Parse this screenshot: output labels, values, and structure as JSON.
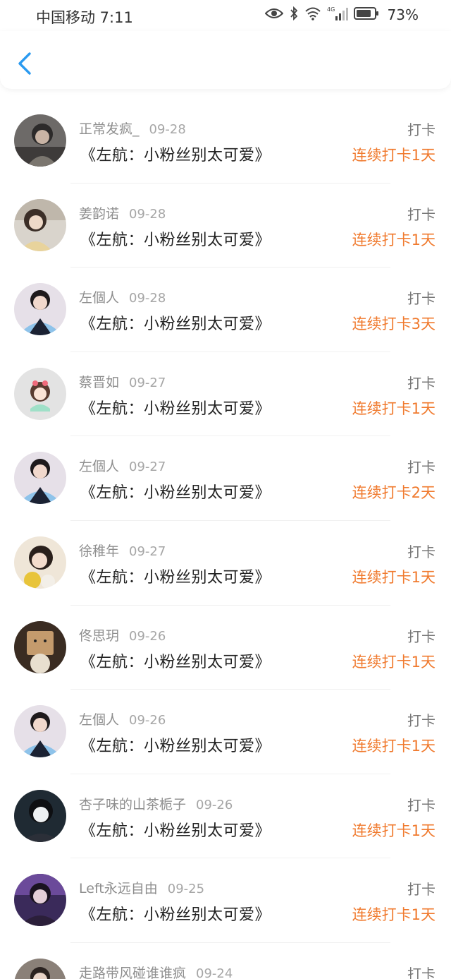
{
  "status_bar": {
    "carrier_time": "中国移动 7:11",
    "network": "4G",
    "battery": "73%"
  },
  "nav": {
    "back_icon": "chevron-left-icon",
    "accent": "#2a9af0"
  },
  "colors": {
    "streak": "#f07a2e",
    "meta": "#8e8e8e"
  },
  "entries": [
    {
      "user": "正常发疯_",
      "date": "09-28",
      "book": "《左航：小粉丝别太可爱》",
      "type": "打卡",
      "streak": "连续打卡1天"
    },
    {
      "user": "姜韵诺",
      "date": "09-28",
      "book": "《左航：小粉丝别太可爱》",
      "type": "打卡",
      "streak": "连续打卡1天"
    },
    {
      "user": "左個人",
      "date": "09-28",
      "book": "《左航：小粉丝别太可爱》",
      "type": "打卡",
      "streak": "连续打卡3天"
    },
    {
      "user": "蔡晋如",
      "date": "09-27",
      "book": "《左航：小粉丝别太可爱》",
      "type": "打卡",
      "streak": "连续打卡1天"
    },
    {
      "user": "左個人",
      "date": "09-27",
      "book": "《左航：小粉丝别太可爱》",
      "type": "打卡",
      "streak": "连续打卡2天"
    },
    {
      "user": "徐稚年",
      "date": "09-27",
      "book": "《左航：小粉丝别太可爱》",
      "type": "打卡",
      "streak": "连续打卡1天"
    },
    {
      "user": "佟思玥",
      "date": "09-26",
      "book": "《左航：小粉丝别太可爱》",
      "type": "打卡",
      "streak": "连续打卡1天"
    },
    {
      "user": "左個人",
      "date": "09-26",
      "book": "《左航：小粉丝别太可爱》",
      "type": "打卡",
      "streak": "连续打卡1天"
    },
    {
      "user": "杏子味的山茶栀子",
      "date": "09-26",
      "book": "《左航：小粉丝别太可爱》",
      "type": "打卡",
      "streak": "连续打卡1天"
    },
    {
      "user": "Left永远自由",
      "date": "09-25",
      "book": "《左航：小粉丝别太可爱》",
      "type": "打卡",
      "streak": "连续打卡1天"
    },
    {
      "user": "走路带风碰谁谁疯",
      "date": "09-24",
      "book": "",
      "type": "打卡",
      "streak": ""
    }
  ]
}
